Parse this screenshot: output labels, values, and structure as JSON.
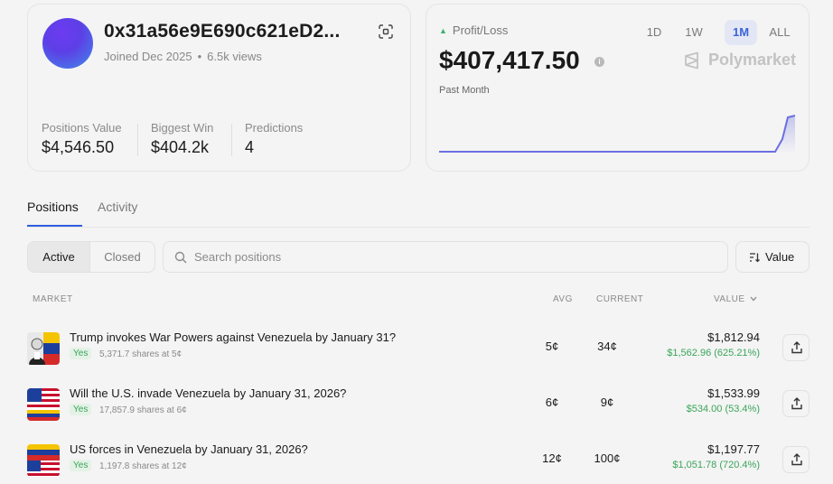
{
  "profile": {
    "address": "0x31a56e9E690c621eD2...",
    "joined": "Joined Dec 2025",
    "views": "6.5k views",
    "stats": [
      {
        "label": "Positions Value",
        "value": "$4,546.50"
      },
      {
        "label": "Biggest Win",
        "value": "$404.2k"
      },
      {
        "label": "Predictions",
        "value": "4"
      }
    ]
  },
  "pnl": {
    "label": "Profit/Loss",
    "value": "$407,417.50",
    "period": "Past Month",
    "ranges": [
      "1D",
      "1W",
      "1M",
      "ALL"
    ],
    "active_range": "1M",
    "brand": "Polymarket",
    "line_color": "#6b6fe0"
  },
  "tabs": {
    "positions": "Positions",
    "activity": "Activity"
  },
  "filters": {
    "active": "Active",
    "closed": "Closed",
    "search_placeholder": "Search positions",
    "sort_label": "Value"
  },
  "table": {
    "headers": {
      "market": "MARKET",
      "avg": "AVG",
      "current": "CURRENT",
      "value": "VALUE"
    },
    "rows": [
      {
        "title": "Trump invokes War Powers against Venezuela by January 31?",
        "outcome": "Yes",
        "shares": "5,371.7 shares at 5¢",
        "avg": "5¢",
        "current": "34¢",
        "value": "$1,812.94",
        "gain": "$1,562.96 (625.21%)"
      },
      {
        "title": "Will the U.S. invade Venezuela by January 31, 2026?",
        "outcome": "Yes",
        "shares": "17,857.9 shares at 6¢",
        "avg": "6¢",
        "current": "9¢",
        "value": "$1,533.99",
        "gain": "$534.00 (53.4%)"
      },
      {
        "title": "US forces in Venezuela by January 31, 2026?",
        "outcome": "Yes",
        "shares": "1,197.8 shares at 12¢",
        "avg": "12¢",
        "current": "100¢",
        "value": "$1,197.77",
        "gain": "$1,051.78 (720.4%)"
      }
    ]
  },
  "colors": {
    "accent": "#2f5fe0",
    "gain": "#3aa55a"
  }
}
